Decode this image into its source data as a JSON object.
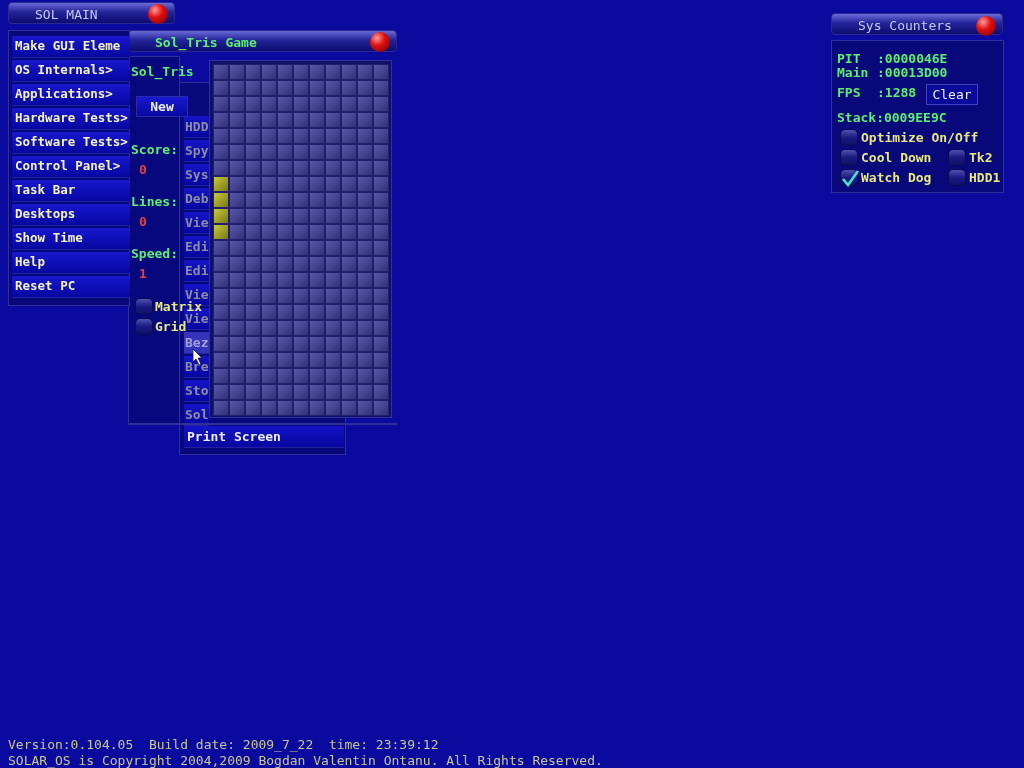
{
  "main_window": {
    "title": "SOL MAIN",
    "items": [
      {
        "label": "Make GUI Eleme"
      },
      {
        "label": "OS Internals>"
      },
      {
        "label": "Applications>"
      },
      {
        "label": "Hardware Tests>"
      },
      {
        "label": "Software Tests>"
      },
      {
        "label": "Control Panel>"
      },
      {
        "label": "Task Bar"
      },
      {
        "label": "Desktops"
      },
      {
        "label": "Show Time"
      },
      {
        "label": "Help"
      },
      {
        "label": "Reset PC"
      }
    ]
  },
  "submenu": {
    "items": [
      {
        "label": "HDD",
        "dimmed": true,
        "selected": false
      },
      {
        "label": "Spy",
        "dimmed": true,
        "selected": false
      },
      {
        "label": "Sys",
        "dimmed": true,
        "selected": false
      },
      {
        "label": "Deb",
        "dimmed": true,
        "selected": false
      },
      {
        "label": "Vie",
        "dimmed": true,
        "selected": false
      },
      {
        "label": "Edi",
        "dimmed": true,
        "selected": false
      },
      {
        "label": "Edi",
        "dimmed": true,
        "selected": false
      },
      {
        "label": "Vie",
        "dimmed": true,
        "selected": false
      },
      {
        "label": "Vie",
        "dimmed": true,
        "selected": false
      },
      {
        "label": "Bez",
        "dimmed": true,
        "selected": true
      },
      {
        "label": "Bre",
        "dimmed": true,
        "selected": false
      },
      {
        "label": "Sto",
        "dimmed": true,
        "selected": false
      },
      {
        "label": "Sol",
        "dimmed": true,
        "selected": false
      },
      {
        "label": "Print Screen",
        "dimmed": false,
        "selected": false
      }
    ]
  },
  "tris_window": {
    "title": "Sol_Tris Game",
    "heading": "Sol_Tris",
    "new_button": "New",
    "stats": [
      {
        "label": "Score:",
        "value": "0"
      },
      {
        "label": "Lines:",
        "value": "0"
      },
      {
        "label": "Speed:",
        "value": "1"
      }
    ],
    "options": [
      {
        "label": "Matrix",
        "checked": false
      },
      {
        "label": "Grid",
        "checked": false
      }
    ],
    "board": {
      "rows": [
        [
          false,
          false,
          false,
          false,
          false,
          false,
          false,
          false,
          false,
          false,
          false
        ],
        [
          false,
          false,
          false,
          false,
          false,
          false,
          false,
          false,
          false,
          false,
          false
        ],
        [
          false,
          false,
          false,
          false,
          false,
          false,
          false,
          false,
          false,
          false,
          false
        ],
        [
          false,
          false,
          false,
          false,
          false,
          false,
          false,
          false,
          false,
          false,
          false
        ],
        [
          false,
          false,
          false,
          false,
          false,
          false,
          false,
          false,
          false,
          false,
          false
        ],
        [
          false,
          false,
          false,
          false,
          false,
          false,
          false,
          false,
          false,
          false,
          false
        ],
        [
          false,
          false,
          false,
          false,
          false,
          false,
          false,
          false,
          false,
          false,
          false
        ],
        [
          true,
          false,
          false,
          false,
          false,
          false,
          false,
          false,
          false,
          false,
          false
        ],
        [
          true,
          false,
          false,
          false,
          false,
          false,
          false,
          false,
          false,
          false,
          false
        ],
        [
          true,
          false,
          false,
          false,
          false,
          false,
          false,
          false,
          false,
          false,
          false
        ],
        [
          true,
          false,
          false,
          false,
          false,
          false,
          false,
          false,
          false,
          false,
          false
        ],
        [
          false,
          false,
          false,
          false,
          false,
          false,
          false,
          false,
          false,
          false,
          false
        ],
        [
          false,
          false,
          false,
          false,
          false,
          false,
          false,
          false,
          false,
          false,
          false
        ],
        [
          false,
          false,
          false,
          false,
          false,
          false,
          false,
          false,
          false,
          false,
          false
        ],
        [
          false,
          false,
          false,
          false,
          false,
          false,
          false,
          false,
          false,
          false,
          false
        ],
        [
          false,
          false,
          false,
          false,
          false,
          false,
          false,
          false,
          false,
          false,
          false
        ],
        [
          false,
          false,
          false,
          false,
          false,
          false,
          false,
          false,
          false,
          false,
          false
        ],
        [
          false,
          false,
          false,
          false,
          false,
          false,
          false,
          false,
          false,
          false,
          false
        ],
        [
          false,
          false,
          false,
          false,
          false,
          false,
          false,
          false,
          false,
          false,
          false
        ],
        [
          false,
          false,
          false,
          false,
          false,
          false,
          false,
          false,
          false,
          false,
          false
        ],
        [
          false,
          false,
          false,
          false,
          false,
          false,
          false,
          false,
          false,
          false,
          false
        ],
        [
          false,
          false,
          false,
          false,
          false,
          false,
          false,
          false,
          false,
          false,
          false
        ]
      ]
    }
  },
  "sys_counters": {
    "title": "Sys Counters",
    "counters": [
      {
        "label": "PIT",
        "value": ":0000046E"
      },
      {
        "label": "Main",
        "value": ":00013D00"
      },
      {
        "label": "FPS",
        "value": ":1288"
      }
    ],
    "clear_button": "Clear",
    "stack": "Stack:0009EE9C",
    "options": [
      {
        "label": "Optimize On/Off",
        "checked": false
      },
      {
        "label": "Cool Down",
        "checked": false
      },
      {
        "label": "Tk2",
        "checked": false
      },
      {
        "label": "Watch Dog",
        "checked": true
      },
      {
        "label": "HDD1",
        "checked": false
      }
    ]
  },
  "footer": {
    "lines": [
      "Version:0.104.05  Build date: 2009_7_22  time: 23:39:12",
      "SOLAR_OS is Copyright 2004,2009 Bogdan Valentin Ontanu. All Rights Reserved."
    ]
  }
}
